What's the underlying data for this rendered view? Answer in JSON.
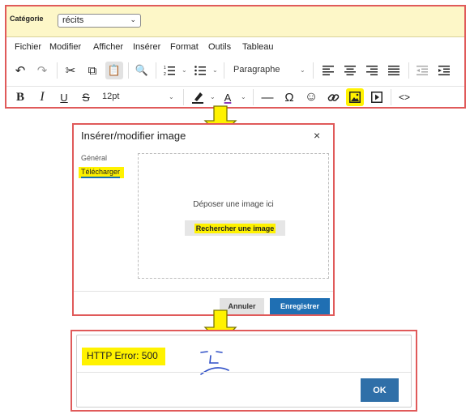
{
  "editor": {
    "category_label": "Catégorie",
    "category_value": "récits",
    "menu": [
      "Fichier",
      "Modifier",
      "Afficher",
      "Insérer",
      "Format",
      "Outils",
      "Tableau"
    ],
    "block_format": "Paragraphe",
    "font_size": "12pt",
    "toolbar_glyphs": {
      "undo": "↶",
      "redo": "↷",
      "cut": "✂",
      "copy": "⧉",
      "paste": "📋",
      "find": "🔍",
      "omega": "Ω",
      "smiley": "☺",
      "link": "🔗",
      "code": "<>",
      "hr": "—",
      "bold": "B",
      "italic": "I",
      "underline": "U",
      "strike": "S",
      "color_a": "A"
    }
  },
  "dialog": {
    "title": "Insérer/modifier image",
    "close": "×",
    "tab_general": "Général",
    "tab_upload": "Télécharger",
    "drop_text": "Déposer une image ici",
    "browse_label": "Rechercher une image",
    "cancel_label": "Annuler",
    "save_label": "Enregistrer"
  },
  "error": {
    "message": "HTTP Error: 500",
    "ok_label": "OK"
  },
  "colors": {
    "highlight": "#fff200",
    "frame": "#e05a5a",
    "primary": "#1f6fb3",
    "category_bar": "#fdf7c8",
    "arrow_fill": "#fff200",
    "arrow_stroke": "#7a7600"
  }
}
